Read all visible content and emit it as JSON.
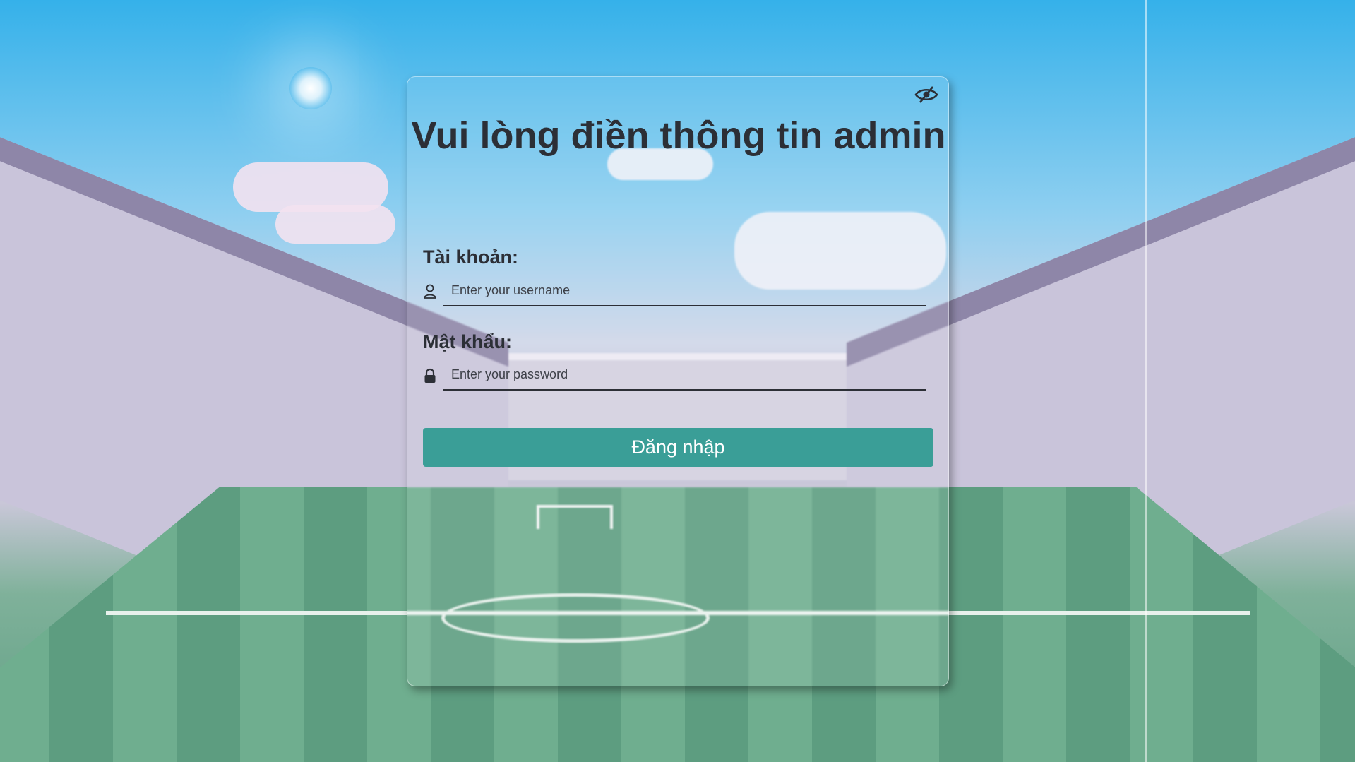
{
  "login": {
    "title": "Vui lòng điền thông tin admin",
    "username_label": "Tài khoản:",
    "username_placeholder": "Enter your username",
    "password_label": "Mật khẩu:",
    "password_placeholder": "Enter your password",
    "submit_label": "Đăng nhập",
    "toggle_icon": "eye-slash-icon",
    "username_icon": "user-icon",
    "password_icon": "lock-icon"
  },
  "colors": {
    "button": "#3a9e97",
    "text": "#2c2f36"
  }
}
